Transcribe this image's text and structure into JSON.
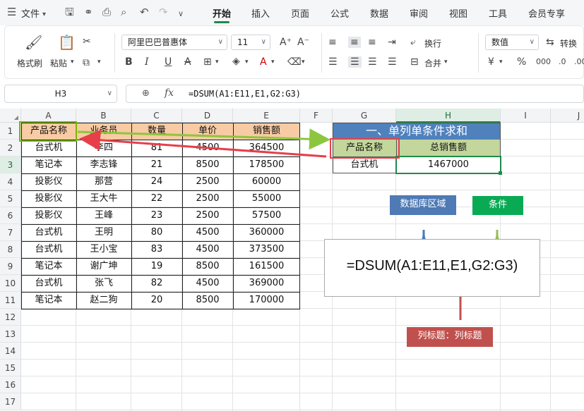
{
  "menubar": {
    "file_label": "文件",
    "tabs": [
      {
        "label": "开始",
        "active": true
      },
      {
        "label": "插入",
        "active": false
      },
      {
        "label": "页面",
        "active": false
      },
      {
        "label": "公式",
        "active": false
      },
      {
        "label": "数据",
        "active": false
      },
      {
        "label": "审阅",
        "active": false
      },
      {
        "label": "视图",
        "active": false
      },
      {
        "label": "工具",
        "active": false
      },
      {
        "label": "会员专享",
        "active": false
      }
    ]
  },
  "ribbon": {
    "format_painter": "格式刷",
    "paste": "粘贴",
    "font_name": "阿里巴巴普惠体",
    "font_size": "11",
    "wrap": "换行",
    "merge": "合并",
    "number_format": "数值",
    "convert": "转换"
  },
  "formula_bar": {
    "name_box": "H3",
    "fx": "fx",
    "formula": "=DSUM(A1:E11,E1,G2:G3)"
  },
  "sheet": {
    "columns": [
      "A",
      "B",
      "C",
      "D",
      "E",
      "F",
      "G",
      "H",
      "I",
      "J"
    ],
    "rows": [
      "1",
      "2",
      "3",
      "4",
      "5",
      "6",
      "7",
      "8",
      "9",
      "10",
      "11",
      "12",
      "13",
      "14",
      "15",
      "16",
      "17"
    ],
    "data_headers": [
      "产品名称",
      "业务员",
      "数量",
      "单价",
      "销售额"
    ],
    "data_rows": [
      [
        "台式机",
        "李四",
        "81",
        "4500",
        "364500"
      ],
      [
        "笔记本",
        "李志锋",
        "21",
        "8500",
        "178500"
      ],
      [
        "投影仪",
        "那营",
        "24",
        "2500",
        "60000"
      ],
      [
        "投影仪",
        "王大牛",
        "22",
        "2500",
        "55000"
      ],
      [
        "投影仪",
        "王峰",
        "23",
        "2500",
        "57500"
      ],
      [
        "台式机",
        "王明",
        "80",
        "4500",
        "360000"
      ],
      [
        "台式机",
        "王小宝",
        "83",
        "4500",
        "373500"
      ],
      [
        "笔记本",
        "谢广坤",
        "19",
        "8500",
        "161500"
      ],
      [
        "台式机",
        "张飞",
        "82",
        "4500",
        "369000"
      ],
      [
        "笔记本",
        "赵二狗",
        "20",
        "8500",
        "170000"
      ]
    ],
    "summary_title": "一、单列单条件求和",
    "summary_headers": [
      "产品名称",
      "总销售额"
    ],
    "summary_criteria": "台式机",
    "summary_result": "1467000"
  },
  "annotation": {
    "formula": "=DSUM(A1:E11,E1,G2:G3)",
    "database_label": "数据库区域",
    "condition_label": "条件",
    "column_label": "列标题：列标题",
    "colors": {
      "blue": "#4e7ab5",
      "green": "#0aaa55",
      "red": "#c0504d",
      "title_bg": "#4f81bd",
      "criteria_bg": "#c3d69b",
      "header_bg": "#f8cba4"
    }
  }
}
